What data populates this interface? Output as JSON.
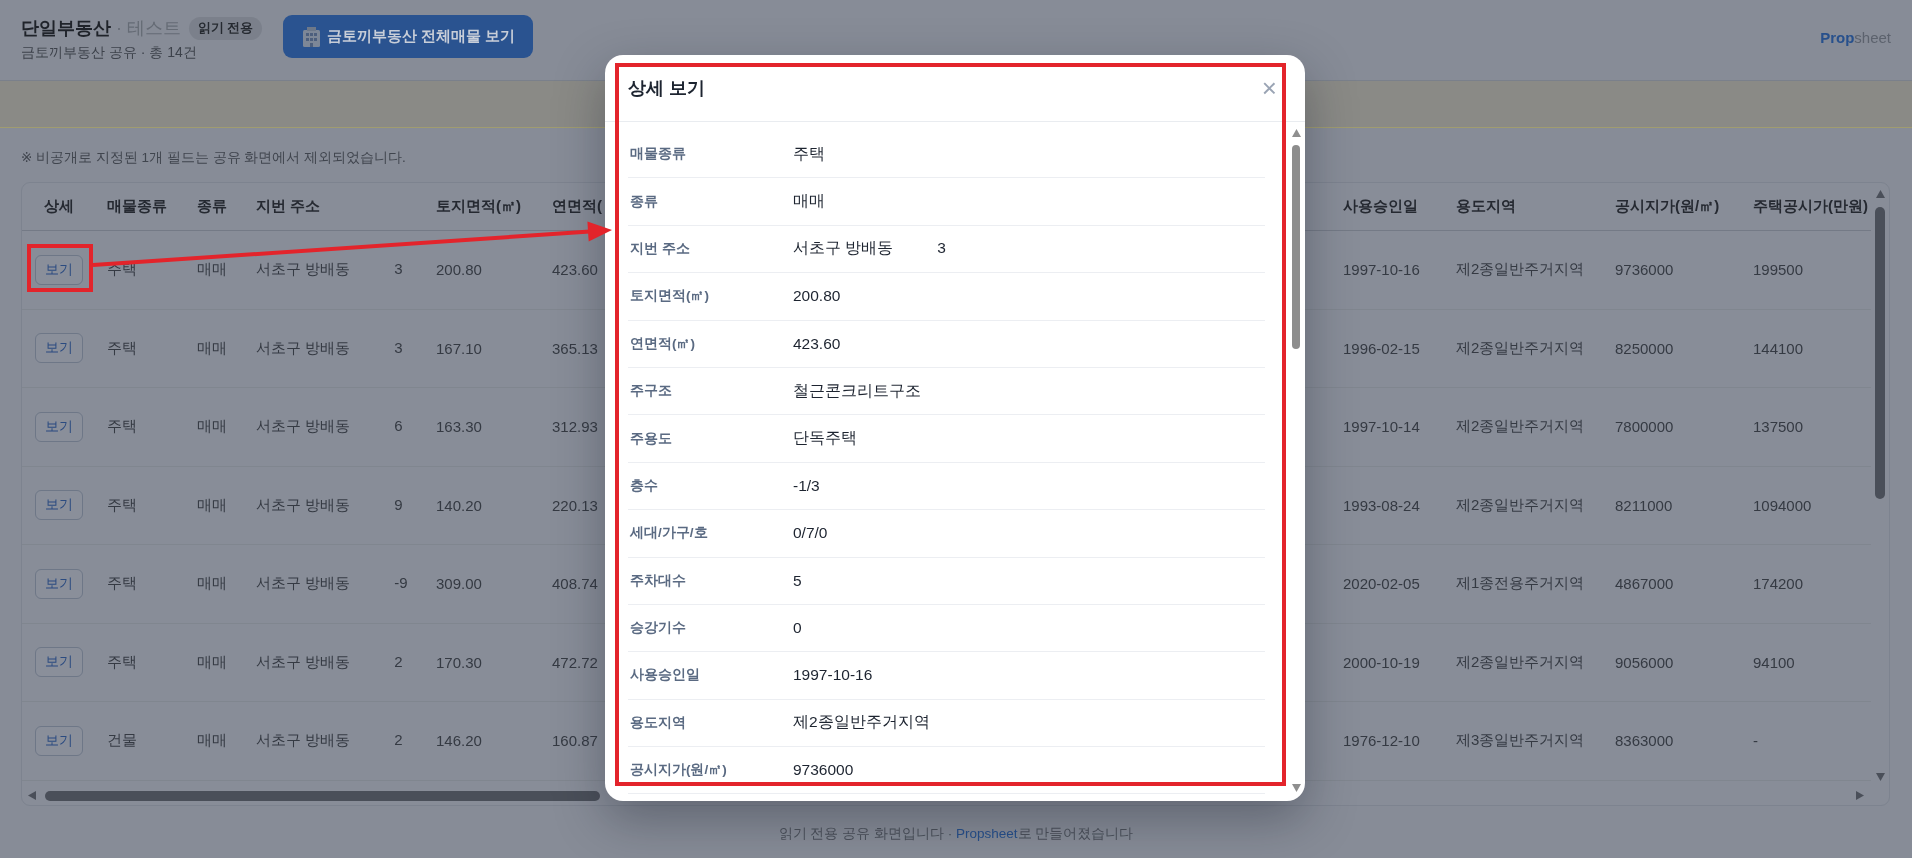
{
  "header": {
    "title": "단일부동산",
    "tag": "· 테스트",
    "badge": "읽기 전용",
    "summary": "금토끼부동산 공유 · 총 14건",
    "all_listings_button": "금토끼부동산 전체매물 보기",
    "brand": "**Prop**sheet"
  },
  "notice": "※ 비공개로 지정된 1개 필드는 공유 화면에서 제외되었습니다.",
  "table": {
    "columns": [
      "상세",
      "매물종류",
      "종류",
      "지번 주소",
      "토지면적(㎡)",
      "연면적(",
      "사용승인일",
      "용도지역",
      "공시지가(원/㎡)",
      "주택공시가(만원)"
    ],
    "rows": [
      {
        "button": "보기",
        "highlighted": true,
        "property_type": "주택",
        "deal_type": "매매",
        "address": "서초구 방배동",
        "address_tail": "3",
        "land_area": "200.80",
        "floor_area": "423.60",
        "approval_date": "1997-10-16",
        "zoning": "제2종일반주거지역",
        "land_price": "9736000",
        "house_price": "199500"
      },
      {
        "button": "보기",
        "highlighted": false,
        "property_type": "주택",
        "deal_type": "매매",
        "address": "서초구 방배동",
        "address_tail": "3",
        "land_area": "167.10",
        "floor_area": "365.13",
        "approval_date": "1996-02-15",
        "zoning": "제2종일반주거지역",
        "land_price": "8250000",
        "house_price": "144100"
      },
      {
        "button": "보기",
        "highlighted": false,
        "property_type": "주택",
        "deal_type": "매매",
        "address": "서초구 방배동",
        "address_tail": "6",
        "land_area": "163.30",
        "floor_area": "312.93",
        "approval_date": "1997-10-14",
        "zoning": "제2종일반주거지역",
        "land_price": "7800000",
        "house_price": "137500"
      },
      {
        "button": "보기",
        "highlighted": false,
        "property_type": "주택",
        "deal_type": "매매",
        "address": "서초구 방배동",
        "address_tail": "9",
        "land_area": "140.20",
        "floor_area": "220.13",
        "approval_date": "1993-08-24",
        "zoning": "제2종일반주거지역",
        "land_price": "8211000",
        "house_price": "1094000"
      },
      {
        "button": "보기",
        "highlighted": false,
        "property_type": "주택",
        "deal_type": "매매",
        "address": "서초구 방배동",
        "address_tail": "-9",
        "land_area": "309.00",
        "floor_area": "408.74",
        "approval_date": "2020-02-05",
        "zoning": "제1종전용주거지역",
        "land_price": "4867000",
        "house_price": "174200"
      },
      {
        "button": "보기",
        "highlighted": false,
        "property_type": "주택",
        "deal_type": "매매",
        "address": "서초구 방배동",
        "address_tail": "2",
        "land_area": "170.30",
        "floor_area": "472.72",
        "approval_date": "2000-10-19",
        "zoning": "제2종일반주거지역",
        "land_price": "9056000",
        "house_price": "94100"
      },
      {
        "button": "보기",
        "highlighted": false,
        "property_type": "건물",
        "deal_type": "매매",
        "address": "서초구 방배동",
        "address_tail": "2",
        "land_area": "146.20",
        "floor_area": "160.87",
        "approval_date": "1976-12-10",
        "zoning": "제3종일반주거지역",
        "land_price": "8363000",
        "house_price": "-"
      }
    ]
  },
  "modal": {
    "title": "상세 보기",
    "close": "×",
    "highlighted": true,
    "fields": [
      {
        "label": "매물종류",
        "value": "주택"
      },
      {
        "label": "종류",
        "value": "매매"
      },
      {
        "label": "지번 주소",
        "value": "서초구 방배동",
        "tail": "3"
      },
      {
        "label": "토지면적(㎡)",
        "value": "200.80"
      },
      {
        "label": "연면적(㎡)",
        "value": "423.60"
      },
      {
        "label": "주구조",
        "value": "철근콘크리트구조"
      },
      {
        "label": "주용도",
        "value": "단독주택"
      },
      {
        "label": "층수",
        "value": "-1/3"
      },
      {
        "label": "세대/가구/호",
        "value": "0/7/0"
      },
      {
        "label": "주차대수",
        "value": "5"
      },
      {
        "label": "승강기수",
        "value": "0"
      },
      {
        "label": "사용승인일",
        "value": "1997-10-16"
      },
      {
        "label": "용도지역",
        "value": "제2종일반주거지역"
      },
      {
        "label": "공시지가(원/㎡)",
        "value": "9736000"
      }
    ]
  },
  "footer": {
    "before": "읽기 전용 공유 화면입니다 · ",
    "link": "Propsheet",
    "after": "로 만들어졌습니다"
  }
}
